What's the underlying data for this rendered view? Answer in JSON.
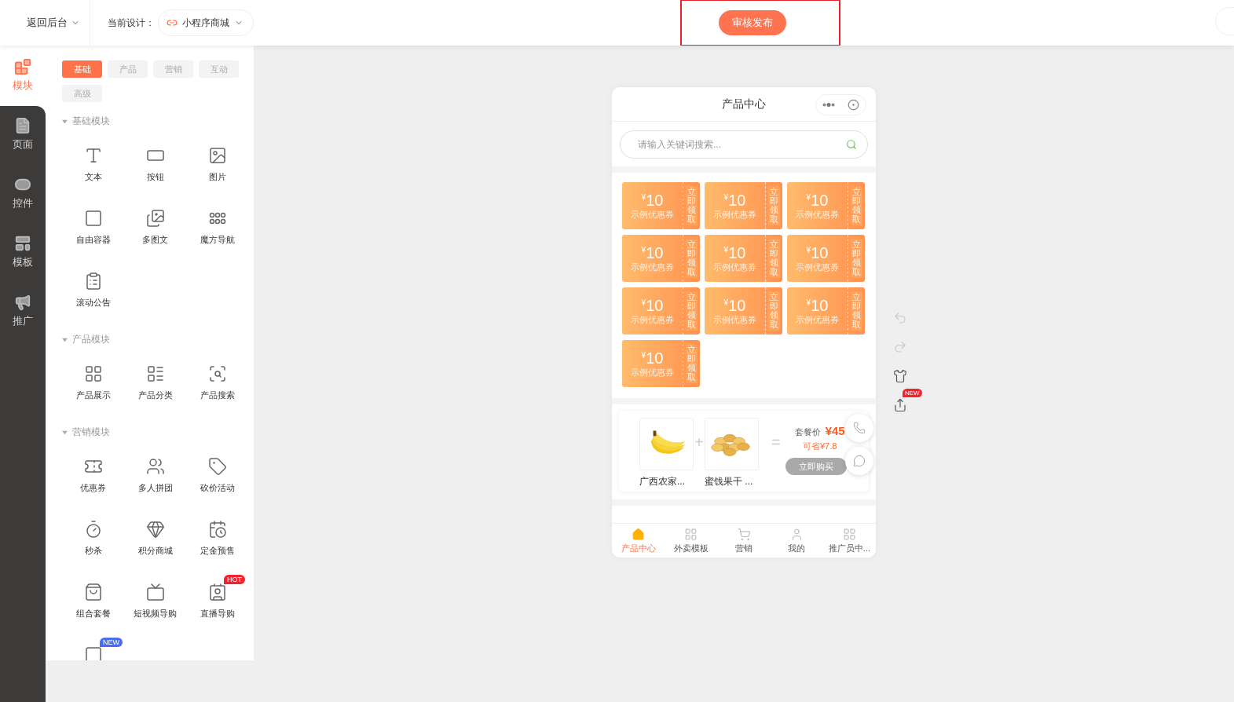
{
  "top_bar": {
    "back_menu": "返回后台",
    "design_label": "当前设计：",
    "design_selector": "小程序商城",
    "publish_button": "审核发布"
  },
  "nav": [
    {
      "label": "模块",
      "selected": true
    },
    {
      "label": "页面",
      "selected": false
    },
    {
      "label": "控件",
      "selected": false
    },
    {
      "label": "模板",
      "selected": false
    },
    {
      "label": "推广",
      "selected": false
    }
  ],
  "module_tabs": [
    {
      "label": "基础",
      "selected": true
    },
    {
      "label": "产品",
      "selected": false
    },
    {
      "label": "营销",
      "selected": false
    },
    {
      "label": "互动",
      "selected": false
    },
    {
      "label": "高级",
      "selected": false
    }
  ],
  "sections": [
    {
      "title": "基础模块",
      "expanded": true,
      "items": [
        {
          "label": "文本"
        },
        {
          "label": "按钮"
        },
        {
          "label": "图片"
        },
        {
          "label": "自由容器"
        },
        {
          "label": "多图文"
        },
        {
          "label": "魔方导航"
        },
        {
          "label": "滚动公告"
        }
      ]
    },
    {
      "title": "产品模块",
      "expanded": true,
      "items": [
        {
          "label": "产品展示"
        },
        {
          "label": "产品分类"
        },
        {
          "label": "产品搜索"
        }
      ]
    },
    {
      "title": "营销模块",
      "expanded": true,
      "items": [
        {
          "label": "优惠券"
        },
        {
          "label": "多人拼团"
        },
        {
          "label": "砍价活动"
        },
        {
          "label": "秒杀"
        },
        {
          "label": "积分商城"
        },
        {
          "label": "定金预售"
        },
        {
          "label": "组合套餐"
        },
        {
          "label": "短视频导购"
        },
        {
          "label": "直播导购",
          "badge": "HOT"
        },
        {
          "badge": "NEW"
        }
      ]
    }
  ],
  "phone": {
    "title": "产品中心",
    "search": {
      "placeholder": "请输入关键词搜索..."
    },
    "coupons": [
      {
        "currency": "¥",
        "amount": "10",
        "label": "示例优惠券",
        "action": "立即领取"
      },
      {
        "currency": "¥",
        "amount": "10",
        "label": "示例优惠券",
        "action": "立即领取"
      },
      {
        "currency": "¥",
        "amount": "10",
        "label": "示例优惠券",
        "action": "立即领取"
      },
      {
        "currency": "¥",
        "amount": "10",
        "label": "示例优惠券",
        "action": "立即领取"
      },
      {
        "currency": "¥",
        "amount": "10",
        "label": "示例优惠券",
        "action": "立即领取"
      },
      {
        "currency": "¥",
        "amount": "10",
        "label": "示例优惠券",
        "action": "立即领取"
      },
      {
        "currency": "¥",
        "amount": "10",
        "label": "示例优惠券",
        "action": "立即领取"
      },
      {
        "currency": "¥",
        "amount": "10",
        "label": "示例优惠券",
        "action": "立即领取"
      },
      {
        "currency": "¥",
        "amount": "10",
        "label": "示例优惠券",
        "action": "立即领取"
      },
      {
        "currency": "¥",
        "amount": "10",
        "label": "示例优惠券",
        "action": "立即领取"
      }
    ],
    "bundle": {
      "products": [
        {
          "name": "广西农家...",
          "kind": "banana"
        },
        {
          "name": "蜜饯果干 ...",
          "kind": "chips"
        }
      ],
      "plus": "+",
      "equals": "=",
      "price_label": "套餐价",
      "price": "¥45",
      "saving": "可省¥7.8",
      "buy_button": {
        "label": "立即购买",
        "disabled": true
      }
    },
    "tabs": [
      {
        "label": "产品中心",
        "selected": true,
        "kind": "home"
      },
      {
        "label": "外卖模板",
        "selected": false,
        "kind": "grid"
      },
      {
        "label": "营销",
        "selected": false,
        "kind": "cart"
      },
      {
        "label": "我的",
        "selected": false,
        "kind": "user"
      },
      {
        "label": "推广员中...",
        "selected": false,
        "kind": "grid"
      }
    ]
  },
  "tools": [
    {
      "kind": "undo",
      "disabled": true
    },
    {
      "kind": "redo",
      "disabled": true
    },
    {
      "kind": "theme",
      "disabled": false
    },
    {
      "kind": "share",
      "disabled": false,
      "badge": "NEW"
    }
  ]
}
